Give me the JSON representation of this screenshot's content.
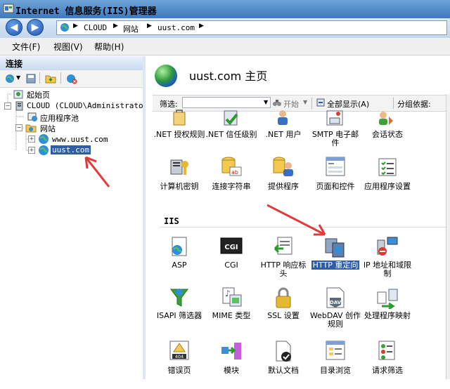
{
  "window": {
    "title": "Internet 信息服务(IIS)管理器"
  },
  "address": {
    "crumbs": [
      "CLOUD",
      "网站",
      "uust.com"
    ]
  },
  "menu": {
    "items": [
      "文件(F)",
      "视图(V)",
      "帮助(H)"
    ]
  },
  "connections": {
    "header": "连接",
    "tree": {
      "start": "起始页",
      "server": "CLOUD (CLOUD\\Administrator)",
      "apppools": "应用程序池",
      "sites": "网站",
      "site1": "www.uust.com",
      "site2": "uust.com"
    }
  },
  "home": {
    "title": "uust.com 主页"
  },
  "filter": {
    "label": "筛选:",
    "start": "开始",
    "showall": "全部显示(A)",
    "groupby": "分组依据:"
  },
  "features_top": [
    {
      "label": ".NET 授权规则",
      "icon": "dotnet-authorization-icon"
    },
    {
      "label": ".NET 信任级别",
      "icon": "dotnet-trust-icon"
    },
    {
      "label": ".NET 用户",
      "icon": "dotnet-users-icon"
    },
    {
      "label": "SMTP 电子邮件",
      "icon": "smtp-email-icon"
    },
    {
      "label": "会话状态",
      "icon": "session-state-icon"
    },
    {
      "label": "计算机密钥",
      "icon": "machine-key-icon"
    },
    {
      "label": "连接字符串",
      "icon": "connection-strings-icon"
    },
    {
      "label": "提供程序",
      "icon": "providers-icon"
    },
    {
      "label": "页面和控件",
      "icon": "pages-controls-icon"
    },
    {
      "label": "应用程序设置",
      "icon": "app-settings-icon"
    }
  ],
  "iis_section": {
    "label": "IIS"
  },
  "features_iis": [
    {
      "label": "ASP",
      "icon": "asp-icon"
    },
    {
      "label": "CGI",
      "icon": "cgi-icon"
    },
    {
      "label": "HTTP 响应标头",
      "icon": "http-response-headers-icon"
    },
    {
      "label": "HTTP 重定向",
      "icon": "http-redirect-icon"
    },
    {
      "label": "IP 地址和域限制",
      "icon": "ip-restrictions-icon"
    },
    {
      "label": "ISAPI 筛选器",
      "icon": "isapi-filters-icon"
    },
    {
      "label": "MIME 类型",
      "icon": "mime-types-icon"
    },
    {
      "label": "SSL 设置",
      "icon": "ssl-settings-icon"
    },
    {
      "label": "WebDAV 创作规则",
      "icon": "webdav-icon"
    },
    {
      "label": "处理程序映射",
      "icon": "handler-mappings-icon"
    },
    {
      "label": "错误页",
      "icon": "error-pages-icon"
    },
    {
      "label": "模块",
      "icon": "modules-icon"
    },
    {
      "label": "默认文档",
      "icon": "default-document-icon"
    },
    {
      "label": "目录浏览",
      "icon": "directory-browsing-icon"
    },
    {
      "label": "请求筛选",
      "icon": "request-filtering-icon"
    }
  ],
  "cgi_badge": "CGI",
  "error_badge": "404",
  "webdav_badge": "DAV",
  "colors": {
    "selection": "#2f5ea8",
    "annotation_arrow": "#e23a3a"
  }
}
